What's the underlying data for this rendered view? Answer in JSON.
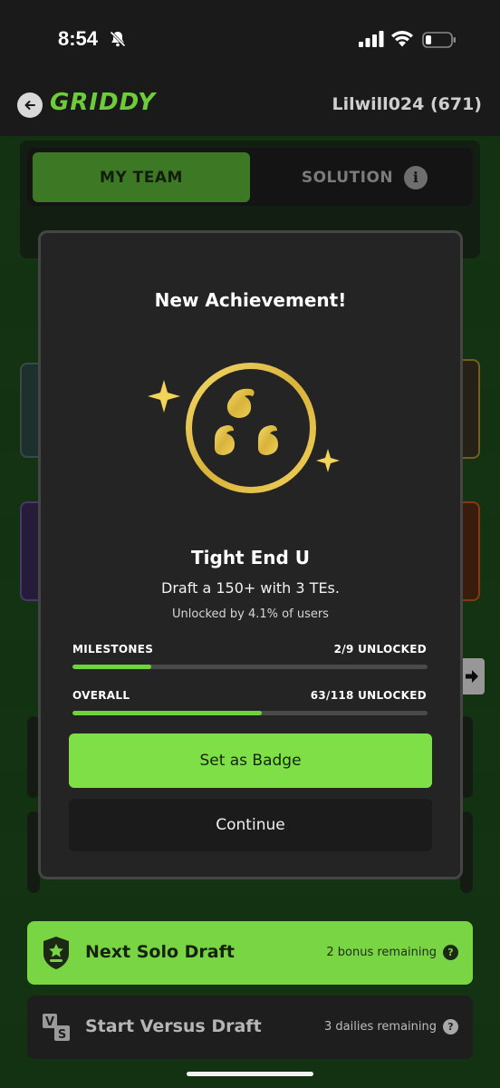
{
  "status_bar": {
    "time": "8:54",
    "icons": [
      "bell-off-icon",
      "signal-icon",
      "wifi-icon",
      "battery-icon"
    ]
  },
  "header": {
    "logo": "GRIDDY",
    "username": "Lilwill024 (671)"
  },
  "tabs": [
    {
      "label": "MY TEAM",
      "active": true
    },
    {
      "label": "SOLUTION",
      "active": false
    }
  ],
  "modal": {
    "title": "New Achievement!",
    "achievement_name": "Tight End U",
    "description": "Draft a 150+ with 3 TEs.",
    "unlocked_by": "Unlocked by 4.1% of users",
    "milestones": {
      "label": "MILESTONES",
      "value": "2/9 UNLOCKED",
      "progress": 0.222
    },
    "overall": {
      "label": "OVERALL",
      "value": "63/118 UNLOCKED",
      "progress": 0.534
    },
    "set_badge_label": "Set as Badge",
    "continue_label": "Continue"
  },
  "draft_buttons": {
    "solo": {
      "title": "Next Solo Draft",
      "sub": "2 bonus remaining"
    },
    "versus": {
      "title": "Start Versus Draft",
      "sub": "3 dailies remaining"
    }
  },
  "colors": {
    "accent": "#7ee046",
    "logo_green": "#6ccc3a",
    "gold": "#e2c04a",
    "modal_bg": "#242424"
  }
}
